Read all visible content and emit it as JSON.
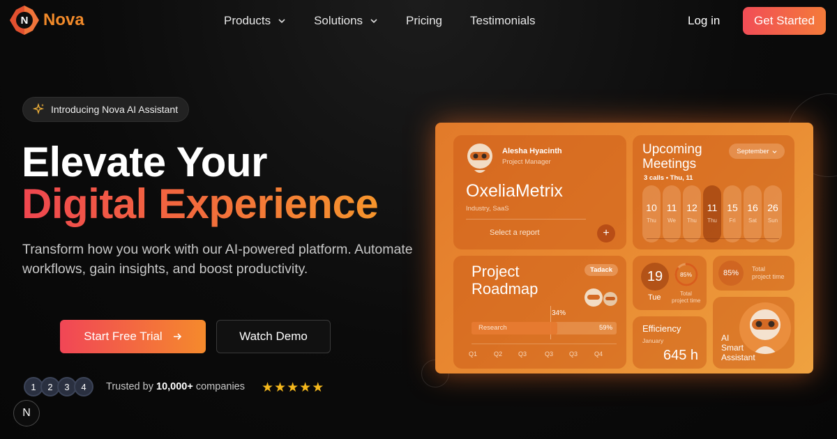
{
  "brand": {
    "logo_letter": "N",
    "name": "Nova"
  },
  "nav": {
    "links": [
      {
        "label": "Products",
        "dropdown": true
      },
      {
        "label": "Solutions",
        "dropdown": true
      },
      {
        "label": "Pricing",
        "dropdown": false
      },
      {
        "label": "Testimonials",
        "dropdown": false
      }
    ],
    "login": "Log in",
    "cta": "Get Started"
  },
  "hero": {
    "badge": "Introducing Nova AI Assistant",
    "headline_1": "Elevate Your",
    "headline_2": "Digital Experience",
    "subtitle": "Transform how you work with our AI-powered platform. Automate workflows, gain insights, and boost productivity.",
    "primary_button": "Start Free Trial",
    "secondary_button": "Watch Demo",
    "avatars": [
      "1",
      "2",
      "3",
      "4"
    ],
    "trusted_prefix": "Trusted by ",
    "trusted_count": "10,000+",
    "trusted_suffix": " companies",
    "rating_stars": 5,
    "corner_badge": "N"
  },
  "dashboard": {
    "profile": {
      "name": "Alesha Hyacinth",
      "role": "Project Manager",
      "company": "OxeliaMetrix",
      "industry": "Industry, SaaS",
      "select_label": "Select a report",
      "add_symbol": "+"
    },
    "meetings": {
      "title_1": "Upcoming",
      "title_2": "Meetings",
      "month": "September",
      "summary": "3 calls  •  Thu, 11",
      "days": [
        {
          "num": "10",
          "name": "Thu"
        },
        {
          "num": "11",
          "name": "We"
        },
        {
          "num": "12",
          "name": "Thu"
        },
        {
          "num": "11",
          "name": "Thu",
          "selected": true
        },
        {
          "num": "15",
          "name": "Fri"
        },
        {
          "num": "16",
          "name": "Sat"
        },
        {
          "num": "26",
          "name": "Sun"
        }
      ]
    },
    "roadmap": {
      "title_1": "Project",
      "title_2": "Roadmap",
      "tag": "Tadack",
      "bar_label": "Research",
      "marker_pct": "34%",
      "bar_pct": "59%",
      "progress": 0.59,
      "quarters": [
        "Q1",
        "Q2",
        "Q3",
        "Q3",
        "Q3",
        "Q4"
      ]
    },
    "date_card": {
      "day": "19",
      "weekday": "Tue",
      "ring_pct": "85%",
      "ring_value": 0.85,
      "label_1": "Total",
      "label_2": "project time"
    },
    "time_card": {
      "pct": "85%",
      "label_1": "Total",
      "label_2": "project time"
    },
    "efficiency": {
      "title": "Efficiency",
      "month": "January",
      "hours": "645 h"
    },
    "assistant": {
      "line_1": "AI",
      "line_2": "Smart",
      "line_3": "Assistant"
    }
  },
  "colors": {
    "accent_red": "#f14656",
    "accent_orange": "#f58a2c",
    "brand_orange": "#f28a2a",
    "star": "#f5b81c"
  }
}
